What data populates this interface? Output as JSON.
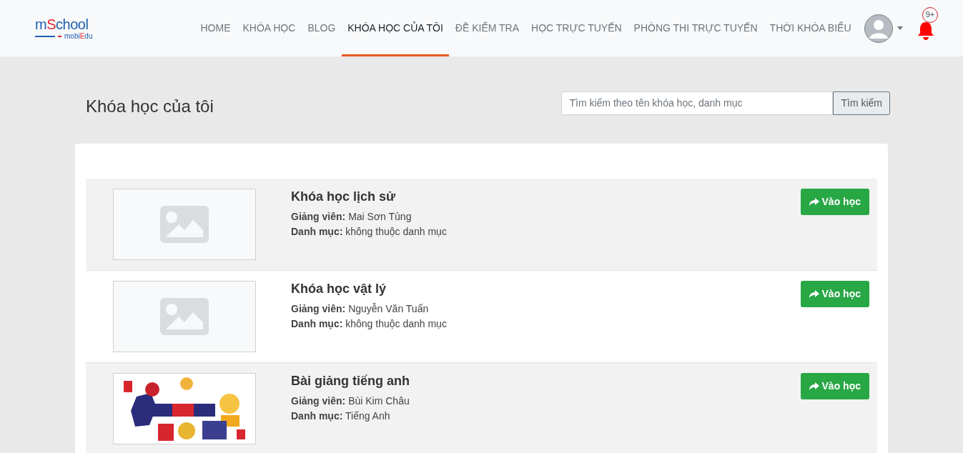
{
  "logo": {
    "title": "mSchool",
    "subtitle": "mobiEdu"
  },
  "nav": [
    {
      "label": "HOME",
      "selected": false
    },
    {
      "label": "KHÓA HỌC",
      "selected": false
    },
    {
      "label": "BLOG",
      "selected": false
    },
    {
      "label": "KHÓA HỌC CỦA TÔI",
      "selected": true
    },
    {
      "label": "ĐỀ KIỂM TRA",
      "selected": false
    },
    {
      "label": "HỌC TRỰC TUYẾN",
      "selected": false
    },
    {
      "label": "PHÒNG THI TRỰC TUYẾN",
      "selected": false
    },
    {
      "label": "THỜI KHÓA BIỂU",
      "selected": false
    }
  ],
  "notifications": {
    "badge": "9+"
  },
  "page_title": "Khóa học của tôi",
  "search": {
    "placeholder": "Tìm kiếm theo tên khóa học, danh mục",
    "button": "Tìm kiếm"
  },
  "courses": [
    {
      "thumbnail": {
        "kind": "placeholder"
      },
      "title": "Khóa học lịch sử",
      "teacher_label": "Giảng viên:",
      "teacher": "Mai Sơn Tùng",
      "category_label": "Danh mục:",
      "category": "không thuộc danh mục",
      "button": "Vào học"
    },
    {
      "thumbnail": {
        "kind": "placeholder"
      },
      "title": "Khóa học vật lý",
      "teacher_label": "Giảng viên:",
      "teacher": "Nguyễn Văn Tuấn",
      "category_label": "Danh mục:",
      "category": "không thuộc danh mục",
      "button": "Vào học"
    },
    {
      "title": "Bài giảng tiếng anh",
      "teacher_label": "Giảng viên:",
      "teacher": "Bùi Kim Châu",
      "category_label": "Danh mục:",
      "category": "Tiếng Anh",
      "button": "Vào học"
    }
  ]
}
